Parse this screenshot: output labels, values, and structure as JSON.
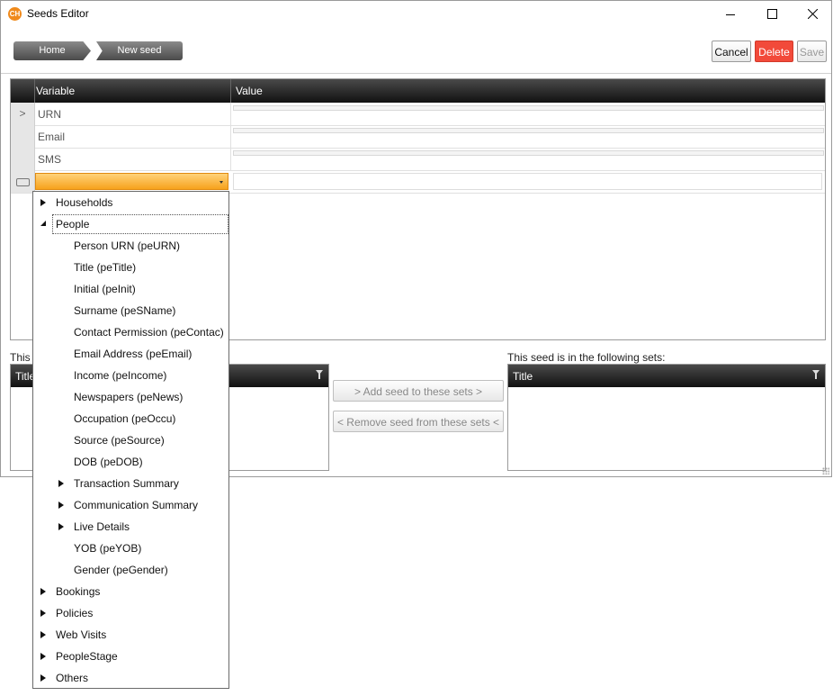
{
  "window": {
    "title": "Seeds Editor",
    "icon_label": "CH"
  },
  "breadcrumbs": [
    {
      "label": "Home"
    },
    {
      "label": "New seed"
    }
  ],
  "toolbar": {
    "cancel_label": "Cancel",
    "delete_label": "Delete",
    "save_label": "Save"
  },
  "grid": {
    "columns": [
      "Variable",
      "Value"
    ],
    "rows": [
      {
        "variable": "URN",
        "indicator": ">"
      },
      {
        "variable": "Email",
        "indicator": ""
      },
      {
        "variable": "SMS",
        "indicator": ""
      }
    ]
  },
  "sets": {
    "left_label": "This s",
    "right_label": "This seed is in the following sets:",
    "left_column": "Title",
    "right_column": "Title",
    "add_label": "> Add seed to these sets >",
    "remove_label": "< Remove seed from these sets <"
  },
  "tree": [
    {
      "label": "Households",
      "level": 0,
      "state": "collapsed"
    },
    {
      "label": "People",
      "level": 0,
      "state": "expanded",
      "focused": true
    },
    {
      "label": "Person URN (peURN)",
      "level": 1,
      "state": "leaf"
    },
    {
      "label": "Title (peTitle)",
      "level": 1,
      "state": "leaf"
    },
    {
      "label": "Initial (peInit)",
      "level": 1,
      "state": "leaf"
    },
    {
      "label": "Surname (peSName)",
      "level": 1,
      "state": "leaf"
    },
    {
      "label": "Contact Permission (peContac)",
      "level": 1,
      "state": "leaf"
    },
    {
      "label": "Email Address (peEmail)",
      "level": 1,
      "state": "leaf"
    },
    {
      "label": "Income (peIncome)",
      "level": 1,
      "state": "leaf"
    },
    {
      "label": "Newspapers (peNews)",
      "level": 1,
      "state": "leaf"
    },
    {
      "label": "Occupation (peOccu)",
      "level": 1,
      "state": "leaf"
    },
    {
      "label": "Source (peSource)",
      "level": 1,
      "state": "leaf"
    },
    {
      "label": "DOB (peDOB)",
      "level": 1,
      "state": "leaf"
    },
    {
      "label": "Transaction Summary",
      "level": 1,
      "state": "collapsed"
    },
    {
      "label": "Communication Summary",
      "level": 1,
      "state": "collapsed"
    },
    {
      "label": "Live Details",
      "level": 1,
      "state": "collapsed"
    },
    {
      "label": "YOB (peYOB)",
      "level": 1,
      "state": "leaf"
    },
    {
      "label": "Gender (peGender)",
      "level": 1,
      "state": "leaf"
    },
    {
      "label": "Bookings",
      "level": 0,
      "state": "collapsed"
    },
    {
      "label": "Policies",
      "level": 0,
      "state": "collapsed"
    },
    {
      "label": "Web Visits",
      "level": 0,
      "state": "collapsed"
    },
    {
      "label": "PeopleStage",
      "level": 0,
      "state": "collapsed"
    },
    {
      "label": "Others",
      "level": 0,
      "state": "collapsed"
    }
  ],
  "colors": {
    "delete": "#f24a3a",
    "combo": "#f7a21c",
    "header_dark": "#111111"
  }
}
